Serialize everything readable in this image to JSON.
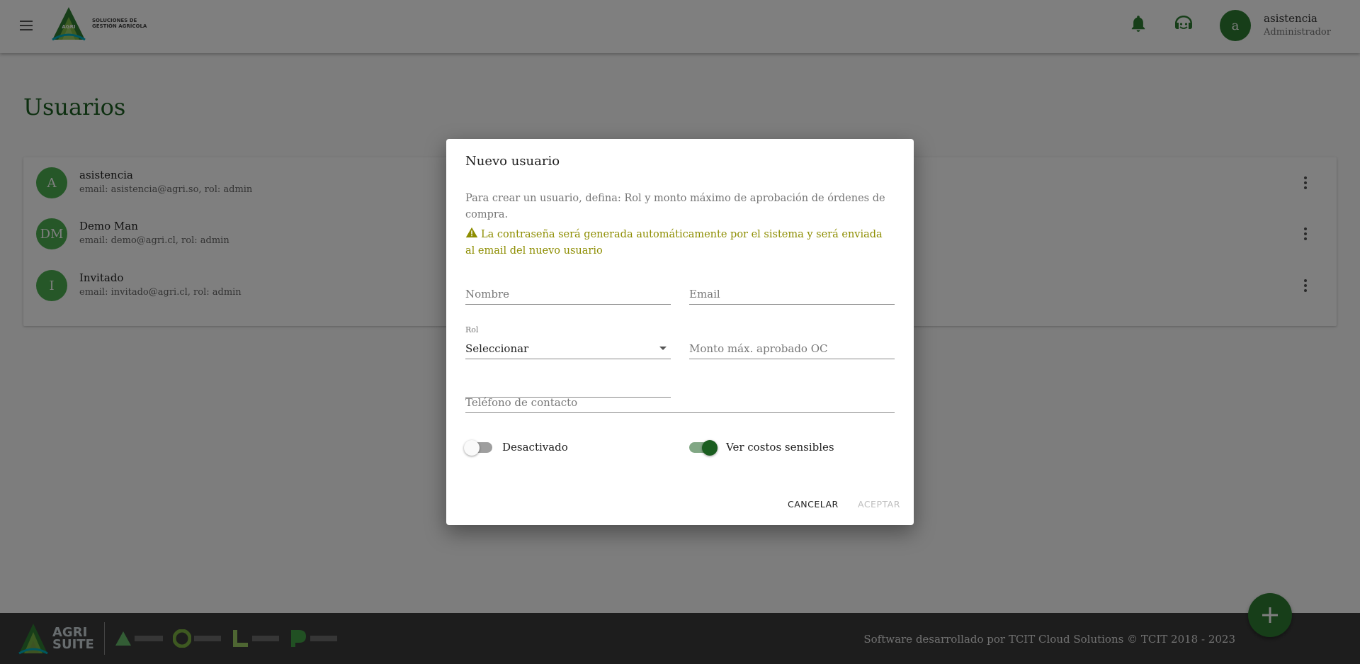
{
  "header": {
    "logo_text_line1": "SOLUCIONES DE",
    "logo_text_line2": "GESTIÓN AGRÍCOLA",
    "user_initial": "a",
    "user_name": "asistencia",
    "user_role": "Administrador"
  },
  "page": {
    "title": "Usuarios"
  },
  "users": [
    {
      "initials": "A",
      "name": "asistencia",
      "detail": "email: asistencia@agri.so, rol: admin"
    },
    {
      "initials": "DM",
      "name": "Demo Man",
      "detail": "email: demo@agri.cl, rol: admin"
    },
    {
      "initials": "I",
      "name": "Invitado",
      "detail": "email: invitado@agri.cl, rol: admin"
    }
  ],
  "dialog": {
    "title": "Nuevo usuario",
    "description": "Para crear un usuario, defina: Rol y monto máximo de aprobación de órdenes de compra.",
    "warning": "La contraseña será generada automáticamente por el sistema y será enviada al email del nuevo usuario",
    "nombre_placeholder": "Nombre",
    "email_placeholder": "Email",
    "rol_label": "Rol",
    "rol_value": "Seleccionar",
    "monto_placeholder": "Monto máx. aprobado OC",
    "telefono_placeholder": "Teléfono de contacto",
    "toggle_active_label": "Desactivado",
    "toggle_active_on": false,
    "toggle_costs_label": "Ver costos sensibles",
    "toggle_costs_on": true,
    "cancel_label": "CANCELAR",
    "accept_label": "ACEPTAR"
  },
  "footer": {
    "suite_line1": "AGRI",
    "suite_line2": "SUITE",
    "copyright": "Software desarrollado por TCIT Cloud Solutions © TCIT 2018 - 2023"
  },
  "colors": {
    "primary": "#2e7d32",
    "avatar": "#4caf50",
    "title_green": "#1b5e20",
    "warning": "#8d8d00",
    "footer_bg": "#3b3b3b"
  },
  "icons": {
    "menu": "menu-icon",
    "notifications": "bell-icon",
    "support": "headset-icon",
    "row_menu": "more-vert-icon",
    "warning": "warning-icon",
    "fab": "plus-icon",
    "select": "caret-down-icon"
  }
}
